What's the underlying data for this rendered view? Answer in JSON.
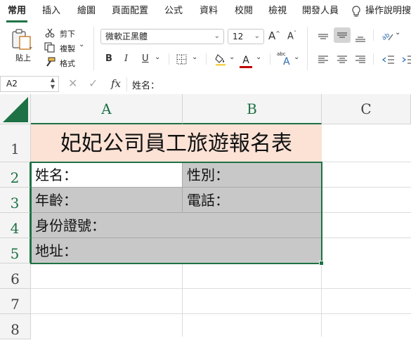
{
  "menu": {
    "tabs": [
      "常用",
      "插入",
      "繪圖",
      "頁面配置",
      "公式",
      "資料",
      "校閱",
      "檢視",
      "開發人員"
    ],
    "tell_me": "操作說明搜"
  },
  "ribbon": {
    "paste_label": "貼上",
    "cut_label": "剪下",
    "copy_label": "複製",
    "format_label": "格式",
    "font_name": "微軟正黑體",
    "font_size": "12",
    "grow_font": "A",
    "shrink_font": "A",
    "bold": "B",
    "italic": "I",
    "underline": "U",
    "font_color_glyph": "A",
    "phonetic_small": "abc",
    "phonetic_glyph": "A"
  },
  "formula_bar": {
    "name_box": "A2",
    "fx_label": "fx",
    "content": "姓名："
  },
  "grid": {
    "columns": [
      "A",
      "B",
      "C"
    ],
    "rows": [
      "1",
      "2",
      "3",
      "4",
      "5",
      "6",
      "7",
      "8"
    ],
    "title": "妃妃公司員工旅遊報名表",
    "name_label": "姓名：",
    "gender_label": "性別：",
    "age_label": "年齡：",
    "phone_label": "電話：",
    "id_label": "身份證號：",
    "address_label": "地址："
  },
  "colors": {
    "accent": "#217346",
    "title_fill": "#fbe2d5",
    "gray_fill": "#c8c8c8"
  }
}
